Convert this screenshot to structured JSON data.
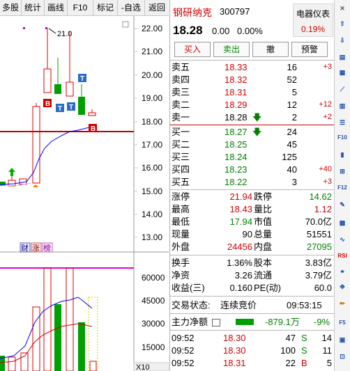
{
  "toolbar": {
    "items": [
      "多股",
      "统计",
      "画线",
      "F10",
      "标记",
      "-自选",
      "返回"
    ]
  },
  "chart": {
    "price_axis": [
      "22.00",
      "21.00",
      "20.00",
      "19.00",
      "18.00",
      "17.00",
      "16.00",
      "15.00",
      "14.00",
      "13.00"
    ],
    "high_annotation": "21.0",
    "volume_axis": [
      "60000",
      "45000",
      "30000",
      "15000"
    ],
    "volume_unit": "X10",
    "badges": [
      "B",
      "T",
      "T",
      "T",
      "B"
    ],
    "event_icons": [
      "财",
      "涨",
      "榜"
    ],
    "colors": {
      "up": "#e00000",
      "down": "#00a000",
      "ma_blue": "#0000ff",
      "ma_red": "#cc0000",
      "magenta": "#e000e0"
    }
  },
  "quote": {
    "name": "钢研纳克",
    "code": "300797",
    "sector": {
      "name": "电器仪表",
      "pct": "0.19%"
    },
    "price": "18.28",
    "change": "0.00",
    "change_pct": "0.00%",
    "buttons": [
      "买入",
      "卖出",
      "撤",
      "预警"
    ],
    "asks": [
      {
        "label": "卖五",
        "price": "18.33",
        "vol": "16",
        "delta": "+3"
      },
      {
        "label": "卖四",
        "price": "18.32",
        "vol": "52",
        "delta": ""
      },
      {
        "label": "卖三",
        "price": "18.31",
        "vol": "5",
        "delta": ""
      },
      {
        "label": "卖二",
        "price": "18.29",
        "vol": "12",
        "delta": "+12"
      },
      {
        "label": "卖一",
        "price": "18.28",
        "vol": "2",
        "delta": "+2"
      }
    ],
    "bids": [
      {
        "label": "买一",
        "price": "18.27",
        "vol": "24",
        "delta": ""
      },
      {
        "label": "买二",
        "price": "18.25",
        "vol": "45",
        "delta": ""
      },
      {
        "label": "买三",
        "price": "18.24",
        "vol": "125",
        "delta": ""
      },
      {
        "label": "买四",
        "price": "18.23",
        "vol": "40",
        "delta": "+40"
      },
      {
        "label": "买五",
        "price": "18.22",
        "vol": "3",
        "delta": "+3"
      }
    ],
    "stats": [
      {
        "l1": "涨停",
        "v1": "21.94",
        "l2": "跌停",
        "v2": "14.62"
      },
      {
        "l1": "最高",
        "v1": "18.43",
        "l2": "量比",
        "v2": "1.12"
      },
      {
        "l1": "最低",
        "v1": "17.94",
        "l2": "市值",
        "v2": "70.0亿"
      },
      {
        "l1": "现量",
        "v1": "90",
        "l2": "总量",
        "v2": "51551"
      },
      {
        "l1": "外盘",
        "v1": "24456",
        "l2": "内盘",
        "v2": "27095"
      }
    ],
    "stats2": [
      {
        "l1": "换手",
        "v1": "1.36%",
        "l2": "股本",
        "v2": "3.83亿"
      },
      {
        "l1": "净资",
        "v1": "3.26",
        "l2": "流通",
        "v2": "3.79亿"
      },
      {
        "l1": "收益(三)",
        "v1": "0.160",
        "l2": "PE(动)",
        "v2": "60.0"
      }
    ],
    "trade_status_label": "交易状态:",
    "trade_status": "连续竞价",
    "trade_time": "09:53:15",
    "net_flow_label": "主力净额",
    "net_flow": "-879.1万",
    "net_flow_pct": "-9%",
    "ticks": [
      {
        "time": "09:52",
        "price": "18.30",
        "vol": "47",
        "side": "S",
        "count": "14"
      },
      {
        "time": "09:52",
        "price": "18.30",
        "vol": "100",
        "side": "S",
        "count": "11"
      },
      {
        "time": "09:52",
        "price": "18.31",
        "vol": "22",
        "side": "B",
        "count": "5"
      }
    ]
  }
}
